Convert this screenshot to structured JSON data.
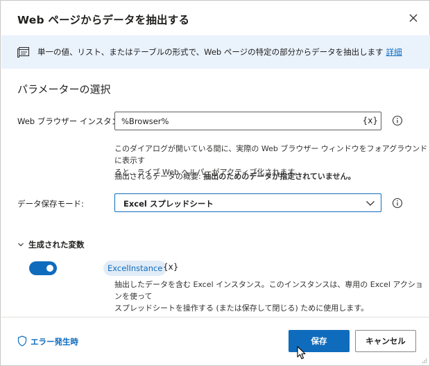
{
  "dialog": {
    "title": "Web ページからデータを抽出する",
    "close_icon": "close-icon"
  },
  "info": {
    "icon": "web-page-icon",
    "text": "単一の値、リスト、またはテーブルの形式で、Web ページの特定の部分からデータを抽出します",
    "link": "詳細"
  },
  "section": {
    "title": "パラメーターの選択"
  },
  "browser": {
    "label": "Web ブラウザー インスタンス:",
    "value": "%Browser%",
    "var_token": "{x}",
    "help_icon": "info-icon"
  },
  "helper_text": {
    "line1": "このダイアログが開いている間に、実際の Web ブラウザー ウィンドウをフォアグラウンドに表示す",
    "line2": "ると、ライブ Web ヘルパーがアクティブ化されます。",
    "summary_label": "抽出されるデータの概要: ",
    "summary_value": "抽出のためのデータが指定されていません。"
  },
  "storage": {
    "label": "データ保存モード:",
    "value": "Excel スプレッドシート",
    "chevron_icon": "chevron-down-icon",
    "help_icon": "info-icon"
  },
  "generated": {
    "title": "生成された変数",
    "chevron_icon": "chevron-down-icon",
    "toggle_on": true,
    "variable": "ExcelInstance",
    "braces": "{x}",
    "desc_line1": "抽出したデータを含む Excel インスタンス。このインスタンスは、専用の Excel アクションを使って",
    "desc_line2": "スプレッドシートを操作する (または保存して閉じる) ために使用します。"
  },
  "footer": {
    "error_label": "エラー発生時",
    "error_icon": "shield-icon",
    "save": "保存",
    "cancel": "キャンセル"
  },
  "colors": {
    "accent": "#0f6cbd",
    "info_bar": "#eaf2fc",
    "chip": "#e1ecf7"
  }
}
